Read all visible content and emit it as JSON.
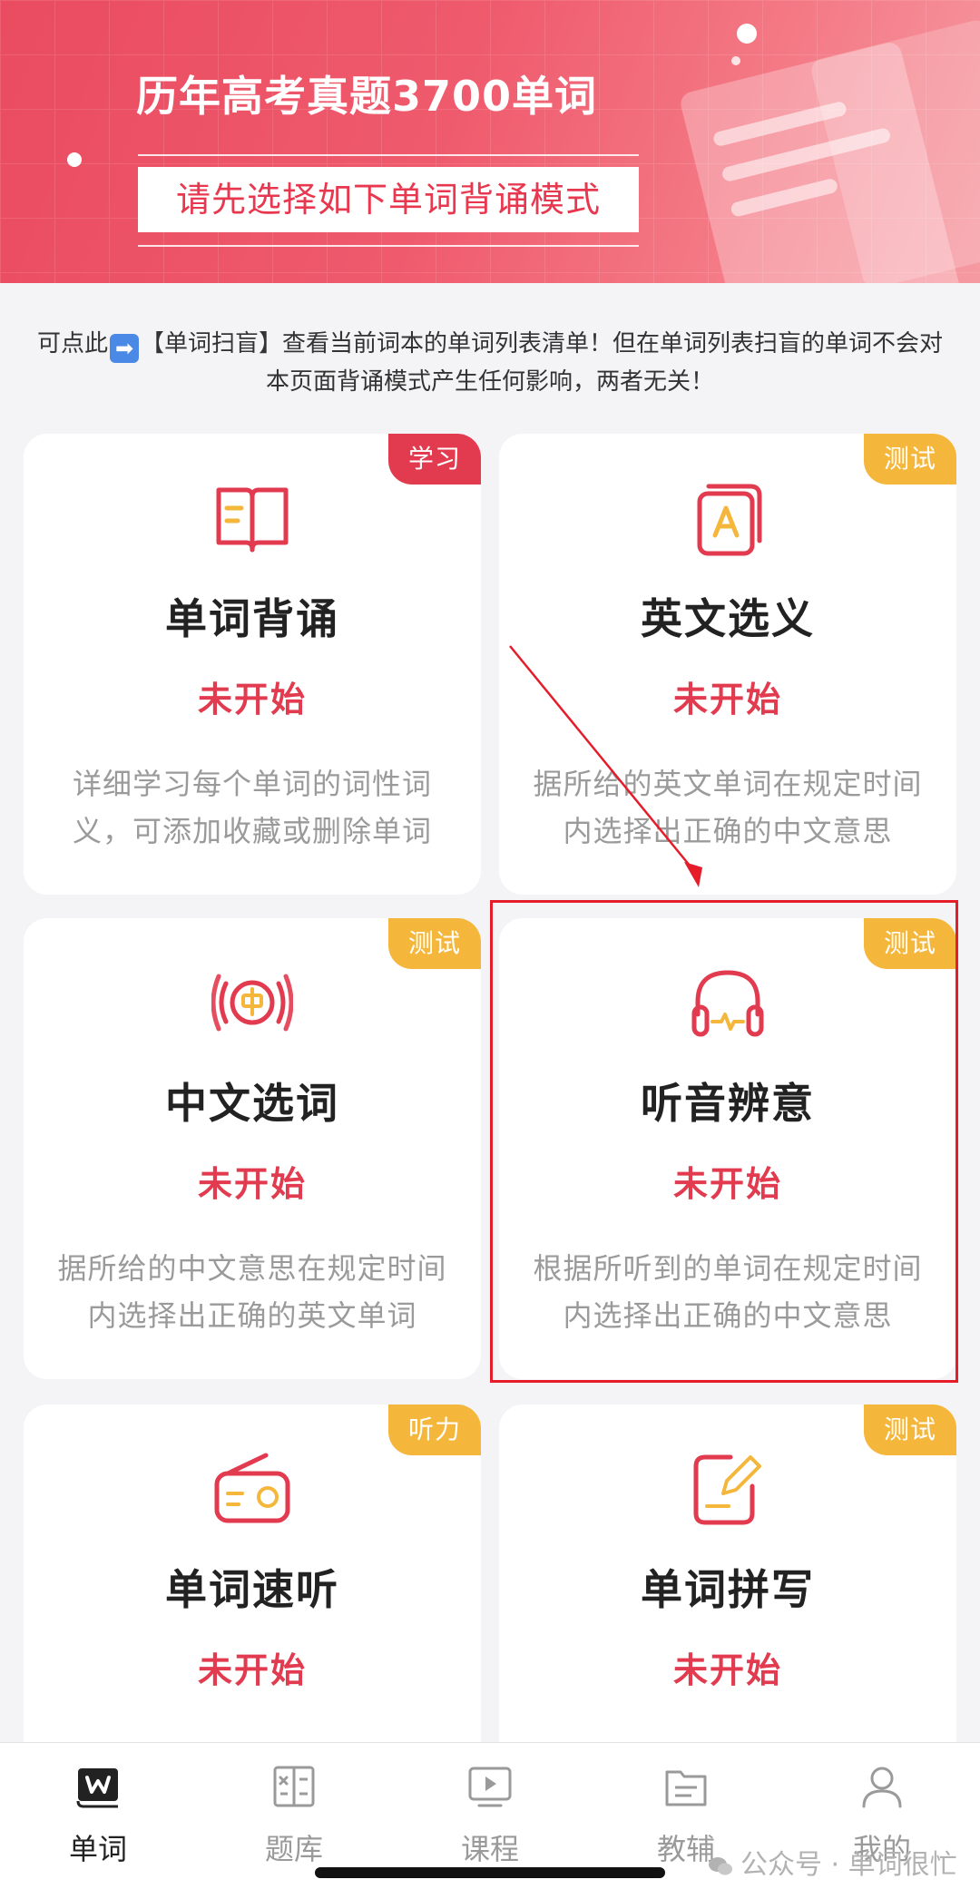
{
  "banner": {
    "title": "历年高考真题3700单词",
    "subtitle": "请先选择如下单词背诵模式"
  },
  "notice": {
    "prefix": "可点此",
    "emoji": "➡",
    "rest": "【单词扫盲】查看当前词本的单词列表清单！但在单词列表扫盲的单词不会对本页面背诵模式产生任何影响，两者无关！"
  },
  "cards": [
    {
      "tag": "学习",
      "tag_color": "#e23b4f",
      "icon": "book-icon",
      "title": "单词背诵",
      "status": "未开始",
      "desc": "详细学习每个单词的词性词义，可添加收藏或删除单词"
    },
    {
      "tag": "测试",
      "tag_color": "#f4b73b",
      "icon": "letter-cards-icon",
      "title": "英文选义",
      "status": "未开始",
      "desc": "据所给的英文单词在规定时间内选择出正确的中文意思"
    },
    {
      "tag": "测试",
      "tag_color": "#f4b73b",
      "icon": "chinese-sound-icon",
      "title": "中文选词",
      "status": "未开始",
      "desc": "据所给的中文意思在规定时间内选择出正确的英文单词"
    },
    {
      "tag": "测试",
      "tag_color": "#f4b73b",
      "icon": "headphones-icon",
      "title": "听音辨意",
      "status": "未开始",
      "desc": "根据所听到的单词在规定时间内选择出正确的中文意思"
    },
    {
      "tag": "听力",
      "tag_color": "#f4b73b",
      "icon": "radio-icon",
      "title": "单词速听",
      "status": "未开始",
      "desc": ""
    },
    {
      "tag": "测试",
      "tag_color": "#f4b73b",
      "icon": "edit-note-icon",
      "title": "单词拼写",
      "status": "未开始",
      "desc": ""
    }
  ],
  "nav": [
    {
      "label": "单词",
      "icon": "word-book-icon",
      "active": true
    },
    {
      "label": "题库",
      "icon": "question-bank-icon",
      "active": false
    },
    {
      "label": "课程",
      "icon": "video-course-icon",
      "active": false
    },
    {
      "label": "教辅",
      "icon": "folder-icon",
      "active": false
    },
    {
      "label": "我的",
      "icon": "user-icon",
      "active": false
    }
  ],
  "watermark": "公众号 · 单词很忙",
  "colors": {
    "accent": "#e23b4f",
    "tag_yellow": "#f4b73b",
    "highlight": "#e51d2a"
  }
}
